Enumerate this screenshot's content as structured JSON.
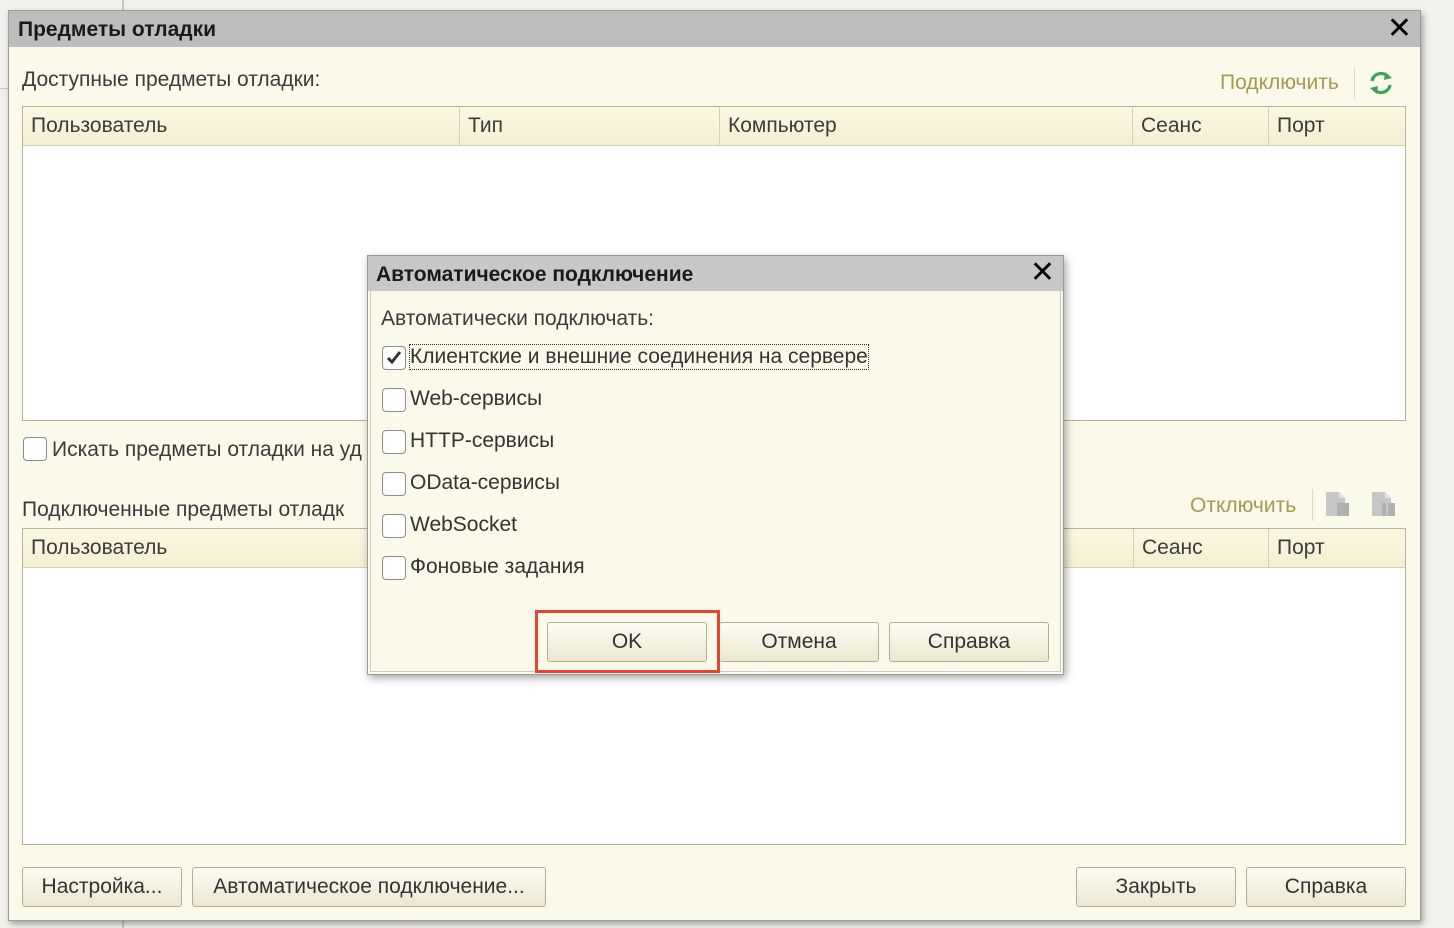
{
  "main_window": {
    "title": "Предметы отладки",
    "available_label": "Доступные предметы отладки:",
    "connect_link": "Подключить",
    "available_columns": [
      "Пользователь",
      "Тип",
      "Компьютер",
      "Сеанс",
      "Порт"
    ],
    "search_remote_label": "Искать предметы отладки на уд",
    "connected_label": "Подключенные предметы отладк",
    "disconnect_link": "Отключить",
    "connected_columns": [
      "Пользователь",
      "Сеанс",
      "Порт"
    ],
    "buttons": {
      "settings": "Настройка...",
      "auto_connect": "Автоматическое подключение...",
      "close": "Закрыть",
      "help": "Справка"
    }
  },
  "dialog": {
    "title": "Автоматическое подключение",
    "prompt": "Автоматически подключать:",
    "options": [
      {
        "label": "Клиентские и внешние соединения на сервере",
        "checked": true
      },
      {
        "label": "Web-сервисы",
        "checked": false
      },
      {
        "label": "HTTP-сервисы",
        "checked": false
      },
      {
        "label": "OData-сервисы",
        "checked": false
      },
      {
        "label": "WebSocket",
        "checked": false
      },
      {
        "label": "Фоновые задания",
        "checked": false
      }
    ],
    "buttons": {
      "ok": "OK",
      "cancel": "Отмена",
      "help": "Справка"
    }
  },
  "icons": {
    "close": "close-icon",
    "refresh": "refresh-icon",
    "doc_a": "document-icon",
    "doc_b": "document-list-icon",
    "checkmark": "checkmark-icon"
  },
  "colors": {
    "window_bg": "#fbf9ea",
    "titlebar": "#bdbdbd",
    "link": "#a49a52",
    "refresh_green": "#3aa35a",
    "highlight": "#e8432f"
  }
}
